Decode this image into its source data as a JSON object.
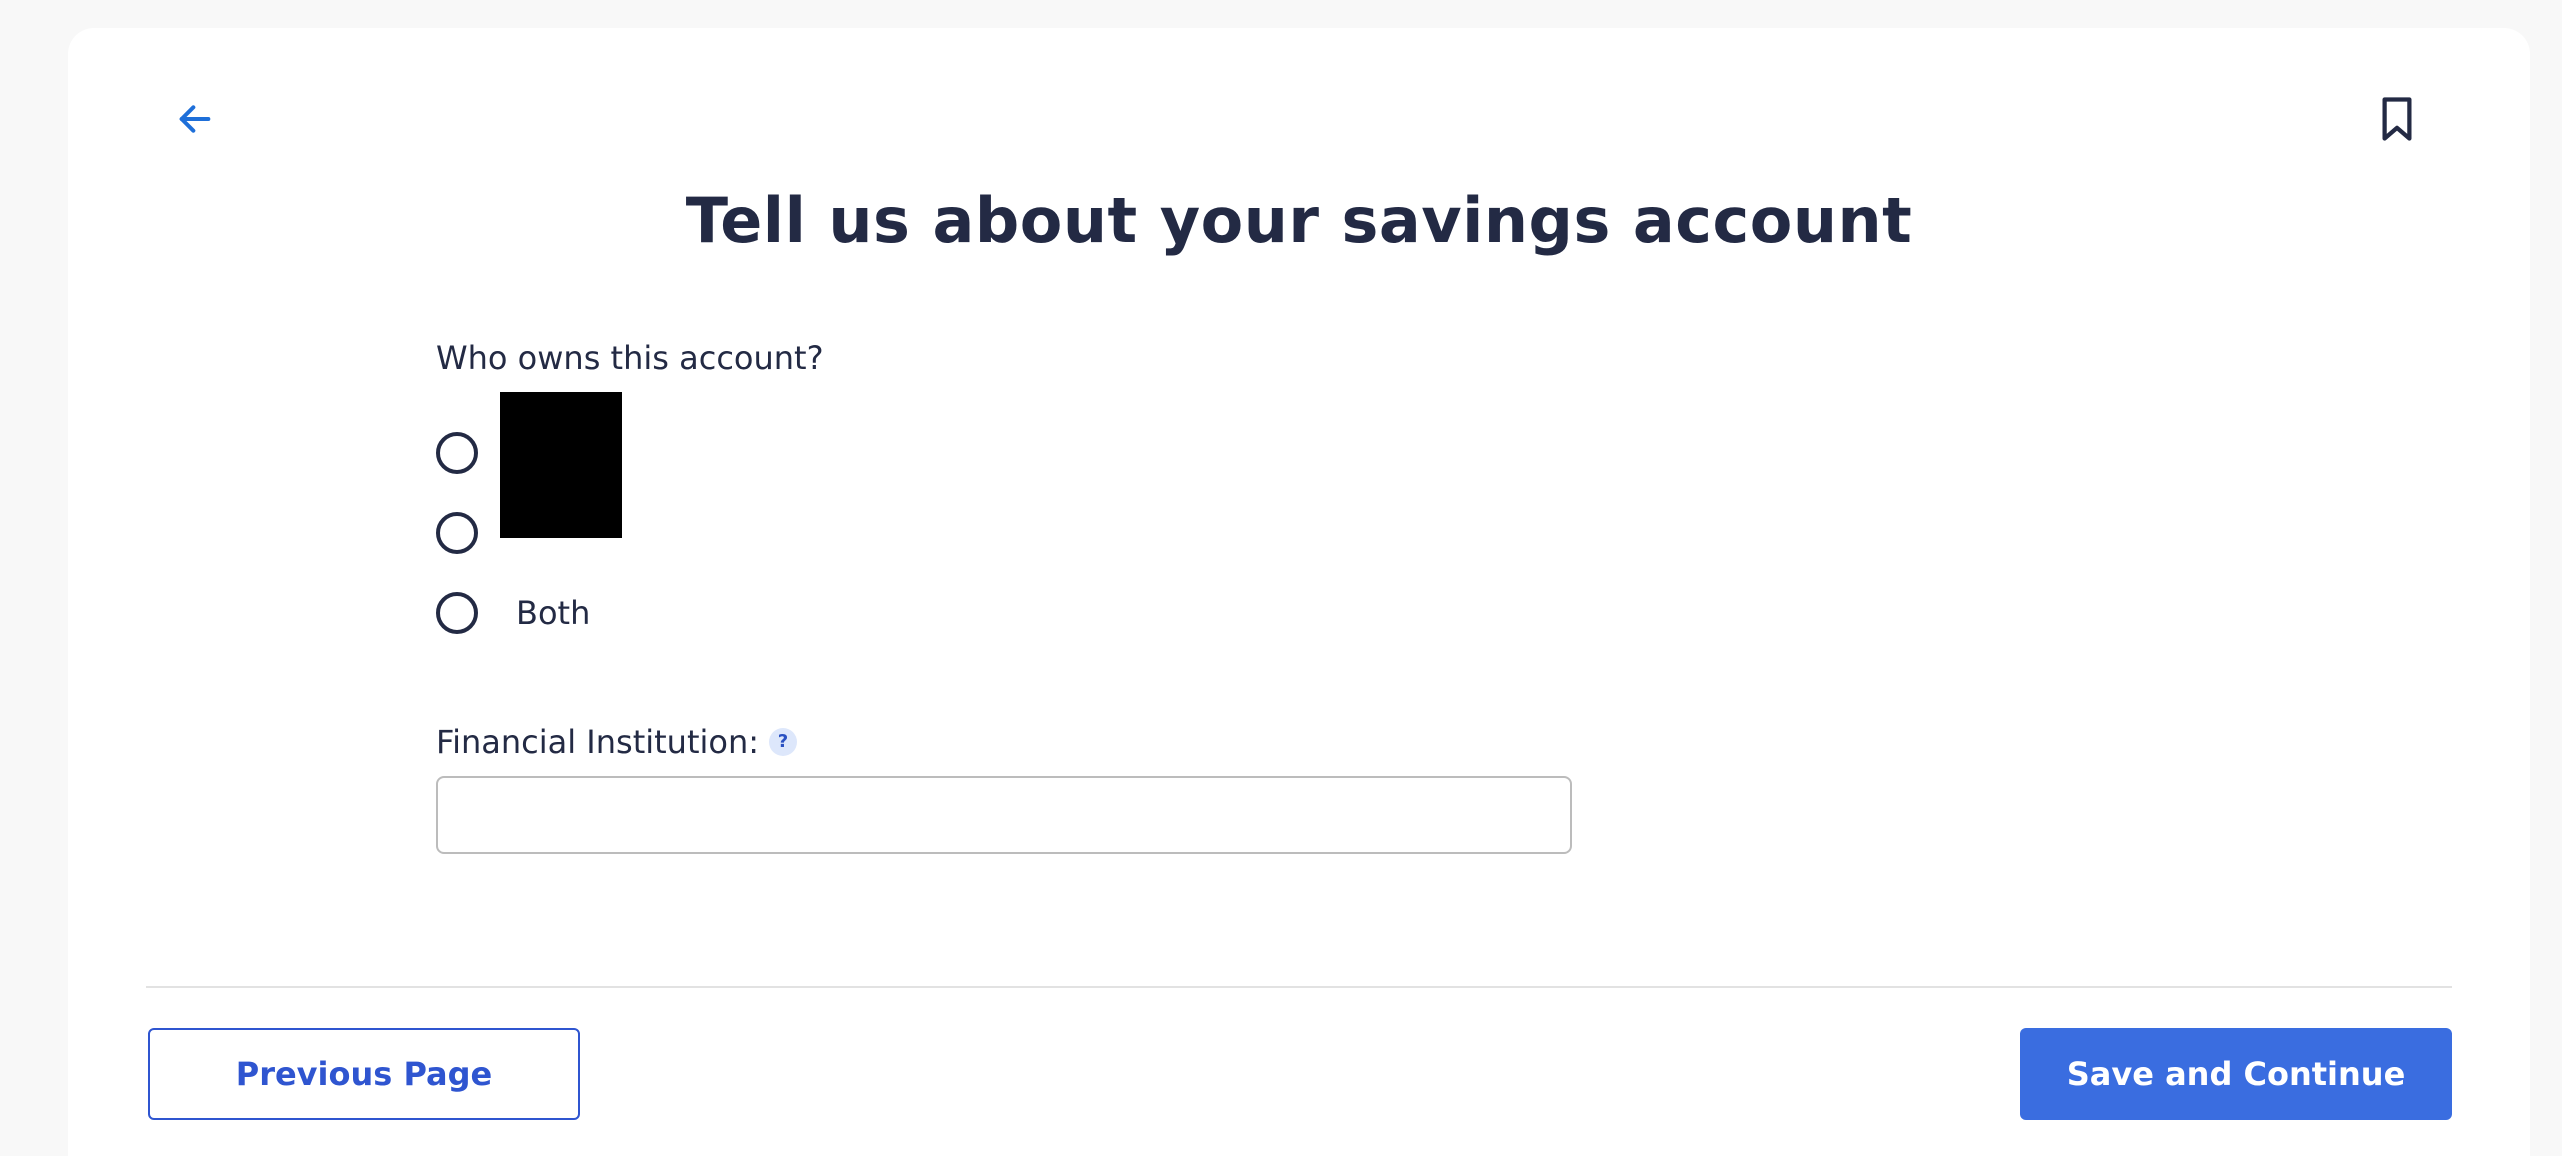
{
  "header": {
    "back_icon": "arrow-left-icon",
    "bookmark_icon": "bookmark-icon",
    "title": "Tell us about your savings account"
  },
  "owner_question": {
    "label": "Who owns this account?",
    "options": [
      {
        "label": "",
        "redacted": true
      },
      {
        "label": "",
        "redacted": true
      },
      {
        "label": "Both",
        "redacted": false
      }
    ]
  },
  "financial_institution": {
    "label": "Financial Institution:",
    "help_icon": "question-mark-icon",
    "help_symbol": "?",
    "value": "",
    "placeholder": ""
  },
  "footer": {
    "previous_label": "Previous Page",
    "save_label": "Save and Continue"
  },
  "colors": {
    "accent_blue": "#3a6de0",
    "link_blue": "#2f55d0",
    "back_arrow": "#1e6fd9",
    "text_dark": "#232a44"
  }
}
